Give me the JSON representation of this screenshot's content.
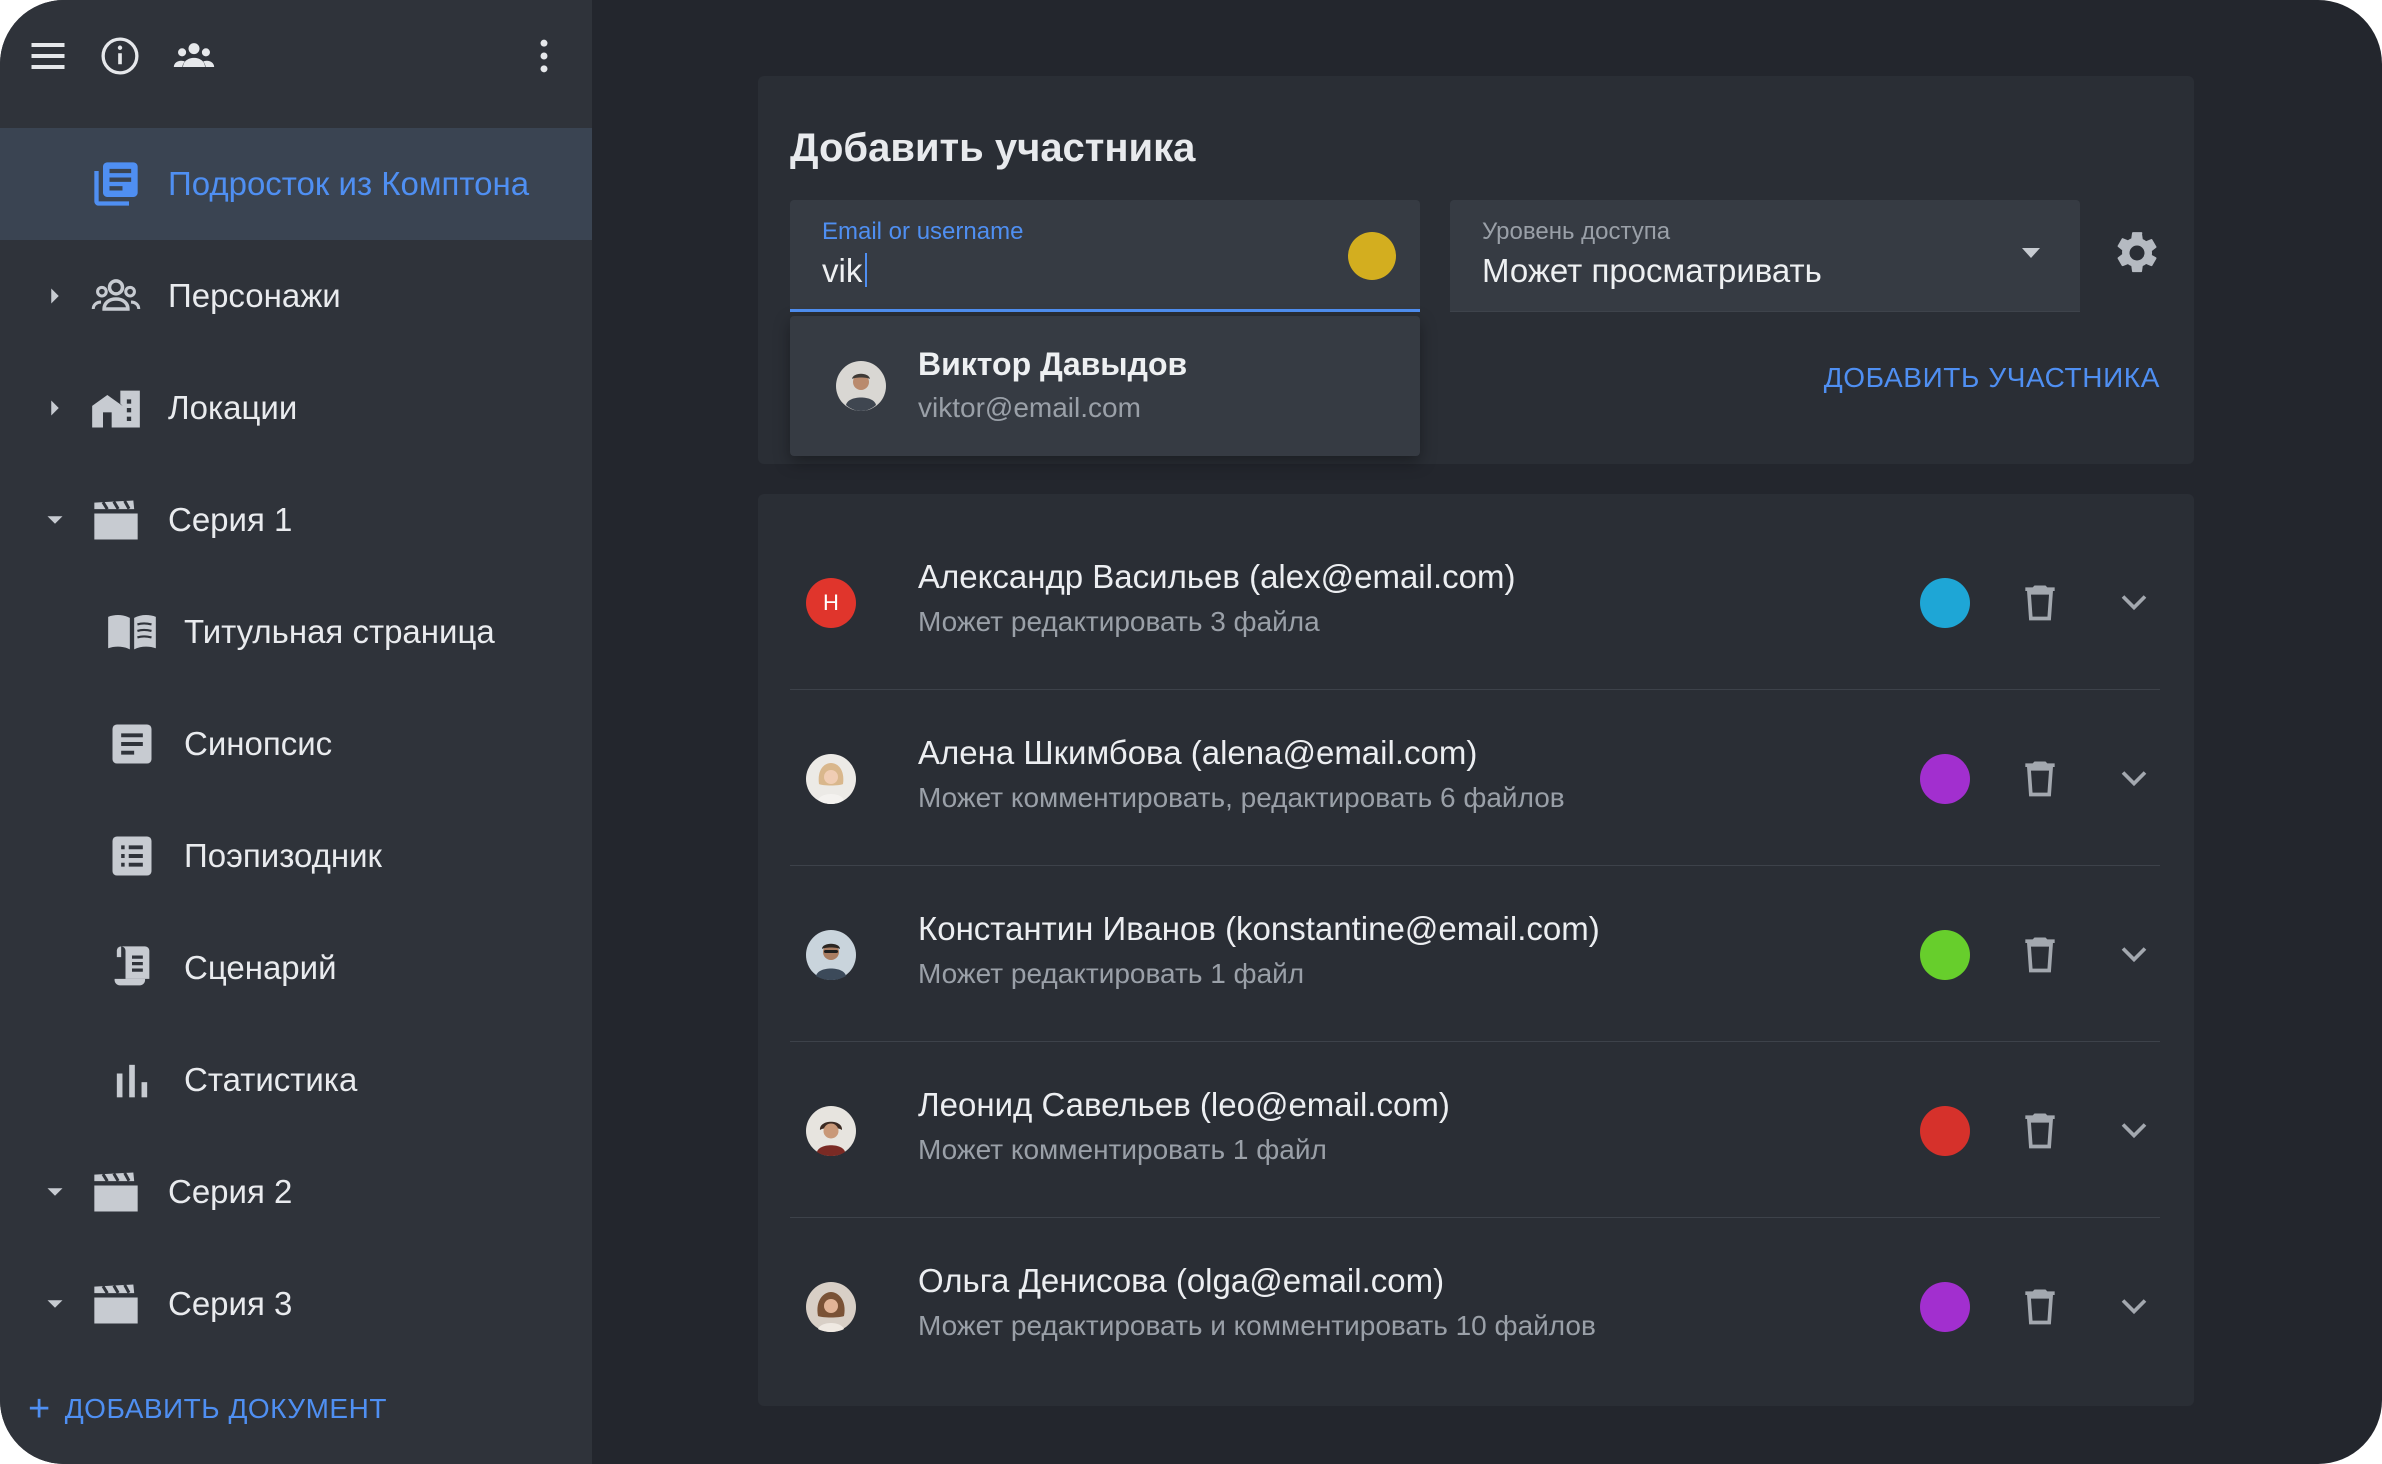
{
  "sidebar": {
    "items": [
      {
        "label": "Подросток из Комптона",
        "active": true
      },
      {
        "label": "Персонажи"
      },
      {
        "label": "Локации"
      },
      {
        "label": "Серия 1"
      },
      {
        "label": "Титульная страница"
      },
      {
        "label": "Синопсис"
      },
      {
        "label": "Поэпизодник"
      },
      {
        "label": "Сценарий"
      },
      {
        "label": "Статистика"
      },
      {
        "label": "Серия 2"
      },
      {
        "label": "Серия 3"
      }
    ],
    "add_document": "ДОБАВИТЬ ДОКУМЕНТ",
    "add_symbol": "+"
  },
  "add_member": {
    "title": "Добавить участника",
    "email_label": "Email or username",
    "email_value": "vik",
    "email_color": "#d3ae1f",
    "access_label": "Уровень доступа",
    "access_value": "Может просматривать",
    "button": "ДОБАВИТЬ УЧАСТНИКА",
    "suggestion": {
      "name": "Виктор Давыдов",
      "email": "viktor@email.com"
    }
  },
  "members": [
    {
      "name": "Александр Васильев (alex@email.com)",
      "permissions": "Может редактировать 3 файла",
      "color": "#1ea6d6",
      "initial": "Н"
    },
    {
      "name": "Алена Шкимбова (alena@email.com)",
      "permissions": "Может комментировать, редактировать 6 файлов",
      "color": "#a22fcf"
    },
    {
      "name": "Константин Иванов (konstantine@email.com)",
      "permissions": "Может редактировать 1 файл",
      "color": "#67ce2c"
    },
    {
      "name": "Леонид Савельев (leo@email.com)",
      "permissions": "Может комментировать 1 файл",
      "color": "#d6312b"
    },
    {
      "name": "Ольга Денисова (olga@email.com)",
      "permissions": "Может редактировать и комментировать 10 файлов",
      "color": "#a22fcf"
    }
  ],
  "accent_color": "#4f8ff2"
}
